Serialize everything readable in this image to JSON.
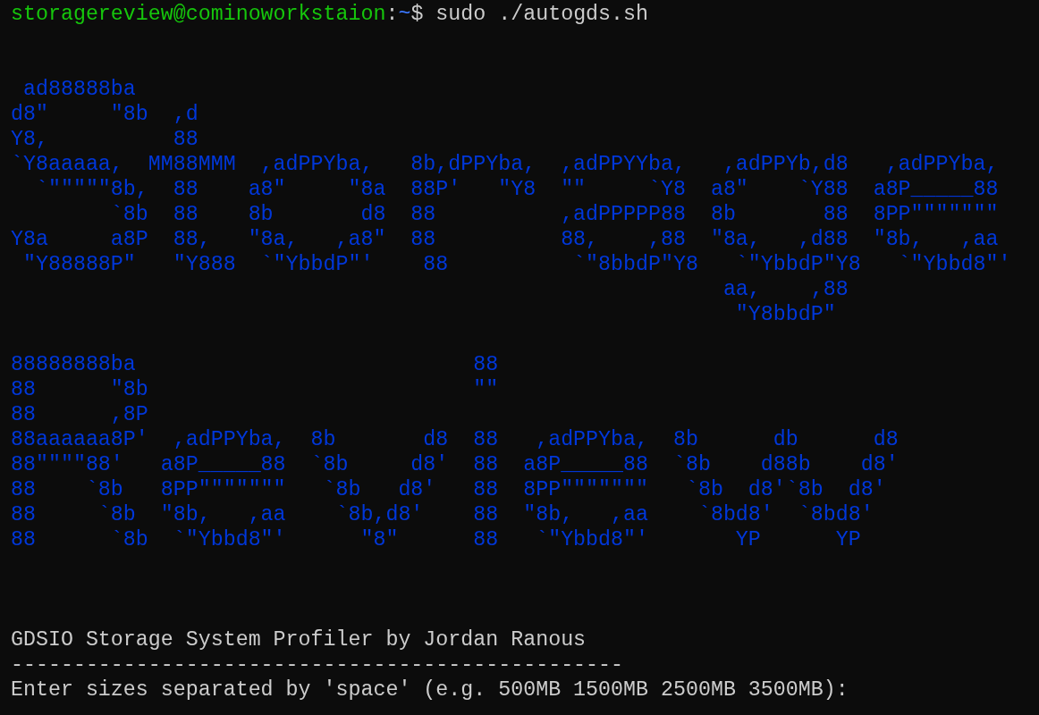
{
  "prompt": {
    "user_host": "storagereview@cominoworkstaion",
    "separator": ":",
    "path": "~",
    "symbol": "$",
    "command": "sudo ./autogds.sh"
  },
  "banner": [
    {
      "lines": [
        " ad88888ba",
        "d8\"     \"8b  ,d",
        "Y8,          88",
        "`Y8aaaaa,  MM88MMM  ,adPPYba,   8b,dPPYba,  ,adPPYYba,   ,adPPYb,d8   ,adPPYba,",
        "  `\"\"\"\"\"8b,  88    a8\"     \"8a  88P'   \"Y8  \"\"     `Y8  a8\"    `Y88  a8P_____88",
        "        `8b  88    8b       d8  88          ,adPPPPP88  8b       88  8PP\"\"\"\"\"\"\"",
        "Y8a     a8P  88,   \"8a,   ,a8\"  88          88,    ,88  \"8a,   ,d88  \"8b,   ,aa",
        " \"Y88888P\"   \"Y888  `\"YbbdP\"'    88          `\"8bbdP\"Y8   `\"YbbdP\"Y8   `\"Ybbd8\"'",
        "                                                         aa,    ,88",
        "                                                          \"Y8bbdP\""
      ]
    },
    {
      "lines": [
        "88888888ba                           88",
        "88      \"8b                          \"\"",
        "88      ,8P",
        "88aaaaaa8P'  ,adPPYba,  8b       d8  88   ,adPPYba,  8b      db      d8",
        "88\"\"\"\"88'   a8P_____88  `8b     d8'  88  a8P_____88  `8b    d88b    d8'",
        "88    `8b   8PP\"\"\"\"\"\"\"   `8b   d8'   88  8PP\"\"\"\"\"\"\"   `8b  d8'`8b  d8'",
        "88     `8b  \"8b,   ,aa    `8b,d8'    88  \"8b,   ,aa    `8bd8'  `8bd8'",
        "88      `8b  `\"Ybbd8\"'      \"8\"      88   `\"Ybbd8\"'       YP      YP"
      ]
    }
  ],
  "output": {
    "title": "GDSIO Storage System Profiler by Jordan Ranous",
    "rule": "-------------------------------------------------",
    "input_prompt": "Enter sizes separated by 'space' (e.g. 500MB 1500MB 2500MB 3500MB):"
  }
}
